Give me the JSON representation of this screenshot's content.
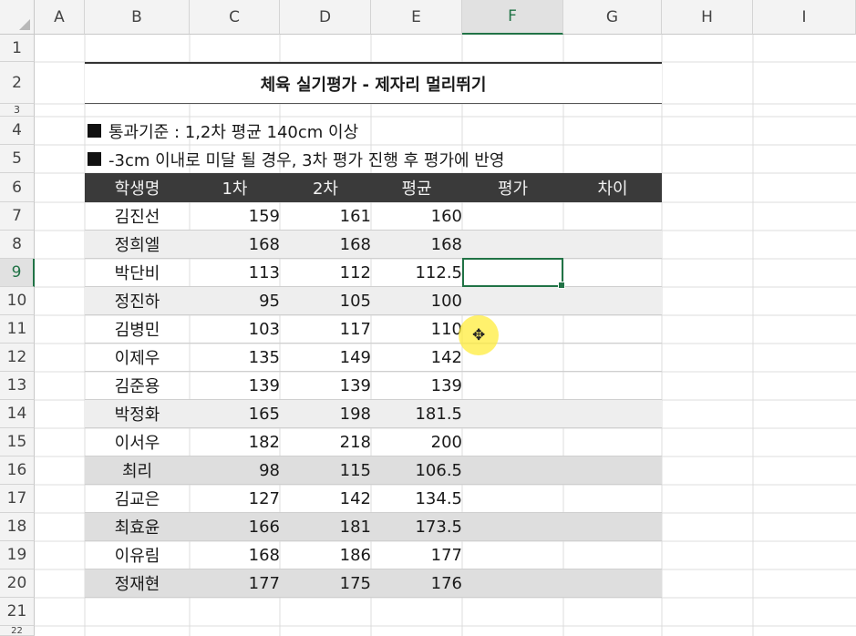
{
  "columns": [
    "A",
    "B",
    "C",
    "D",
    "E",
    "F",
    "G",
    "H",
    "I"
  ],
  "selected_column": "F",
  "rows": [
    "1",
    "2",
    "3",
    "4",
    "5",
    "6",
    "7",
    "8",
    "9",
    "10",
    "11",
    "12",
    "13",
    "14",
    "15",
    "16",
    "17",
    "18",
    "19",
    "20",
    "21",
    "22"
  ],
  "selected_row": "9",
  "title": "체육 실기평가 - 제자리 멀리뛰기",
  "notes": [
    "통과기준 : 1,2차 평균 140cm 이상",
    "-3cm 이내로 미달 될 경우, 3차 평가 진행 후 평가에 반영"
  ],
  "table": {
    "headers": [
      "학생명",
      "1차",
      "2차",
      "평균",
      "평가",
      "차이"
    ],
    "rows": [
      {
        "name": "김진선",
        "r1": "159",
        "r2": "161",
        "avg": "160"
      },
      {
        "name": "정희엘",
        "r1": "168",
        "r2": "168",
        "avg": "168"
      },
      {
        "name": "박단비",
        "r1": "113",
        "r2": "112",
        "avg": "112.5"
      },
      {
        "name": "정진하",
        "r1": "95",
        "r2": "105",
        "avg": "100"
      },
      {
        "name": "김병민",
        "r1": "103",
        "r2": "117",
        "avg": "110"
      },
      {
        "name": "이제우",
        "r1": "135",
        "r2": "149",
        "avg": "142"
      },
      {
        "name": "김준용",
        "r1": "139",
        "r2": "139",
        "avg": "139"
      },
      {
        "name": "박정화",
        "r1": "165",
        "r2": "198",
        "avg": "181.5"
      },
      {
        "name": "이서우",
        "r1": "182",
        "r2": "218",
        "avg": "200"
      },
      {
        "name": "최리",
        "r1": "98",
        "r2": "115",
        "avg": "106.5"
      },
      {
        "name": "김교은",
        "r1": "127",
        "r2": "142",
        "avg": "134.5"
      },
      {
        "name": "최효윤",
        "r1": "166",
        "r2": "181",
        "avg": "173.5"
      },
      {
        "name": "이유림",
        "r1": "168",
        "r2": "186",
        "avg": "177"
      },
      {
        "name": "정재현",
        "r1": "177",
        "r2": "175",
        "avg": "176"
      }
    ]
  },
  "colors": {
    "header_bg": "#3a3a3a",
    "selection": "#217346",
    "cursor_highlight": "#ffec3c"
  }
}
